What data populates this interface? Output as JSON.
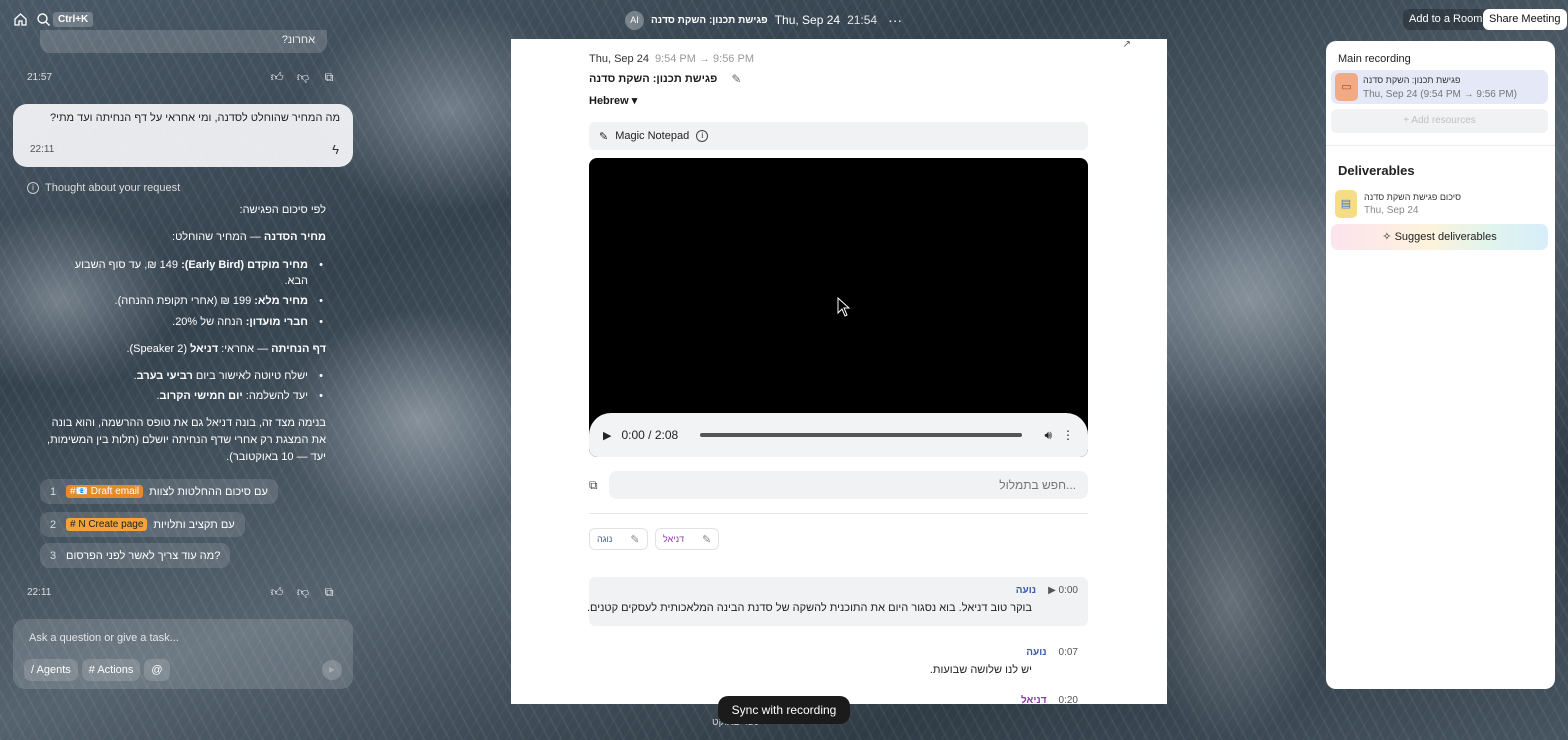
{
  "topbar": {
    "shortcut": "Ctrl+K",
    "ai_badge": "AI",
    "meeting_title": "פגישת תכנון: השקת סדנה",
    "date": "Thu, Sep 24",
    "time": "21:54",
    "more": "···",
    "add_room": "Add to a Room",
    "share": "Share Meeting"
  },
  "chat": {
    "prev_bubble_tail": "אחרונ?",
    "prev_time": "21:57",
    "user_question": "מה המחיר שהוחלט לסדנה, ומי אחראי על דף הנחיתה ועד מתי?",
    "user_time": "22:11",
    "thought": "Thought about your request",
    "summary_intro": "לפי סיכום הפגישה:",
    "price_heading_bold": "מחיר הסדנה",
    "price_heading_rest": " — המחיר שהוחלט:",
    "price_items": [
      {
        "bold": "מחיר מוקדם (Early Bird):",
        "rest": " 149 ₪, עד סוף השבוע"
      },
      {
        "bold": "",
        "rest": "הבא."
      },
      {
        "bold": "מחיר מלא:",
        "rest": " 199 ₪ (אחרי תקופת ההנחה)."
      },
      {
        "bold": "חברי מועדון:",
        "rest": " הנחה של 20%."
      }
    ],
    "landing_bold": "דף הנחיתה",
    "landing_mid": " — אחראי: ",
    "landing_name": "דניאל",
    "landing_rest": " (Speaker 2).",
    "landing_items": [
      {
        "rest": "ישלח טיוטה לאישור ביום ",
        "bold": "רביעי בערב",
        "end": "."
      },
      {
        "rest": "יעד להשלמה: ",
        "bold": "יום חמישי הקרוב",
        "end": "."
      }
    ],
    "paragraph": [
      "בנימה מצד זה, בונה דניאל גם את טופס ההרשמה, והוא בונה",
      "את המצגת רק אחרי שדף הנחיתה יושלם (תלות בין המשימות,",
      "יעד — 10 באוקטובר)."
    ],
    "suggestions": [
      {
        "num": "1",
        "text": "עם סיכום ההחלטות לצוות",
        "chip": "#📧 Draft email"
      },
      {
        "num": "2",
        "text": "עם תקציב ותלויות",
        "chip": "# N Create page"
      },
      {
        "num": "3",
        "text": "מה עוד צריך לאשר לפני הפרסום?",
        "chip": ""
      }
    ],
    "answer_time": "22:11",
    "ask_placeholder": "Ask a question or give a task...",
    "ask_chips": [
      "/ Agents",
      "# Actions",
      "@"
    ]
  },
  "meeting": {
    "date": "Thu, Sep 24",
    "range": "9:54 PM → 9:56 PM",
    "title": "פגישת תכנון: השקת סדנה",
    "language": "Hebrew",
    "notepad": "Magic Notepad",
    "player_time": "0:00 / 2:08",
    "progress": 0,
    "search_placeholder": "...חפש בתמלול",
    "speakers": [
      "נוגה",
      "דניאל"
    ],
    "segments": [
      {
        "name": "נועה",
        "time": "0:00",
        "text": "בוקר טוב דניאל. בוא נסגור היום את התוכנית להשקה של סדנת הבינה המלאכותית לעסקים קטנים."
      },
      {
        "name": "נועה",
        "time": "0:07",
        "text": "יש לנו שלושה שבועות."
      },
      {
        "name": "דניאל",
        "time": "0:20",
        "text": ""
      }
    ],
    "sync_button": "Sync with recording",
    "bottom_ghost": "עשר באוקט"
  },
  "right_panel": {
    "main_recording_label": "Main recording",
    "recording_title": "פגישת תכנון: השקת סדנה",
    "recording_sub": "Thu, Sep 24 (9:54 PM → 9:56 PM)",
    "add_resources": "+ Add resources",
    "deliverables_label": "Deliverables",
    "doc_title": "סיכום פגישת השקת סדנה",
    "doc_date": "Thu, Sep 24",
    "suggest": "Suggest deliverables"
  }
}
